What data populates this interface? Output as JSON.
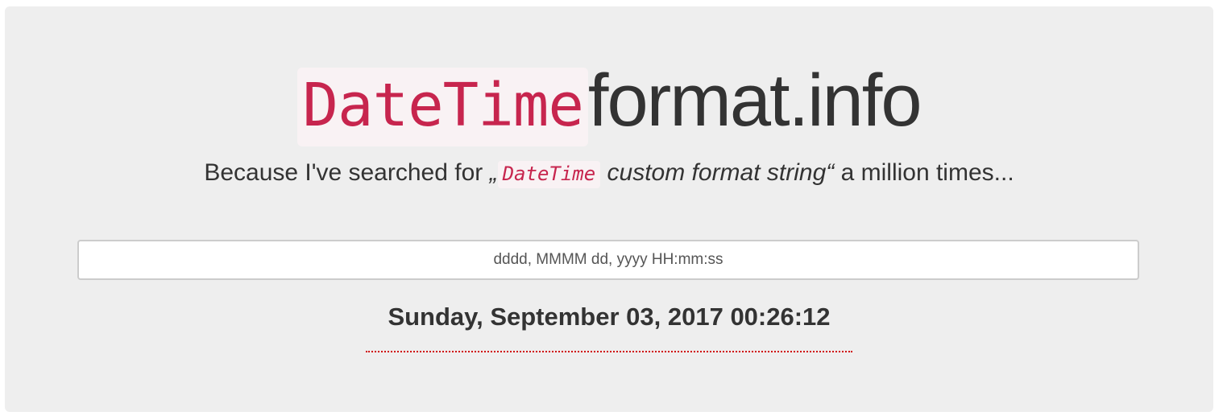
{
  "header": {
    "title_code": "DateTime",
    "title_rest": "format.info"
  },
  "subtitle": {
    "prefix": "Because I've searched for ",
    "open_quote": "„",
    "code": "DateTime",
    "italic": " custom format string",
    "close_quote": "“",
    "suffix": " a million times..."
  },
  "format_input": {
    "value": "dddd, MMMM dd, yyyy HH:mm:ss"
  },
  "result": {
    "text": "Sunday, September 03, 2017 00:26:12"
  },
  "colors": {
    "code_text": "#c7254e",
    "code_bg": "#f9f2f4",
    "panel_bg": "#eeeeee",
    "text": "#333333",
    "underline": "#d00000"
  }
}
